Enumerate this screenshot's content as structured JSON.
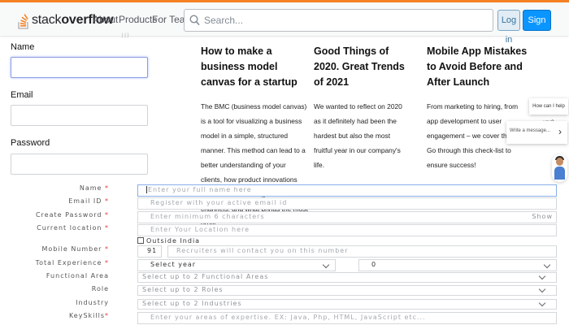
{
  "header": {
    "logo_text_light": "stack",
    "logo_text_bold": "overflow",
    "nav": [
      "About",
      "Products",
      "For Teams"
    ],
    "search_placeholder": "Search...",
    "login_label": "Log in",
    "signup_label": "Sign up",
    "colors": {
      "accent": "#f48024",
      "primary": "#0a95ff"
    }
  },
  "simple_form": {
    "stray_text": "|   |   )",
    "fields": [
      {
        "label": "Name",
        "value": ""
      },
      {
        "label": "Email",
        "value": ""
      },
      {
        "label": "Password",
        "value": ""
      }
    ]
  },
  "articles": [
    {
      "title": "How to make a business model canvas for a startup",
      "body": "The BMC (business model canvas) is a tool for visualizing a business model in a simple, structured manner. This method can lead to a better understanding of your clients, how product innovations are distributed through what channels, and what brings the most profit."
    },
    {
      "title": "Good Things of 2020. Great Trends of 2021",
      "body": "We wanted to reflect on 2020 as it definitely had been the hardest but also the most fruitful year in our company's life."
    },
    {
      "title": "Mobile App Mistakes to Avoid Before and After Launch",
      "body": "From marketing to hiring, from app development to user engagement – we cover them all. Go through this check-list to ensure success!"
    }
  ],
  "chat": {
    "bubble": "How can I help you?",
    "input_placeholder": "Write a message...",
    "send_icon": "chevron-right-icon",
    "avatar_icon": "support-agent-avatar"
  },
  "registration": {
    "required_marker": "*",
    "name": {
      "label": "Name",
      "placeholder": "Enter your full name here"
    },
    "email": {
      "label": "Email ID",
      "placeholder": "Register with your active email id"
    },
    "password": {
      "label": "Create Password",
      "placeholder": "Enter minimum 6 characters",
      "show_label": "Show"
    },
    "location": {
      "label": "Current location",
      "placeholder": "Enter Your Location here"
    },
    "outside_india": {
      "label": "Outside India",
      "checked": false
    },
    "mobile": {
      "label": "Mobile Number",
      "code": "91",
      "placeholder": "Recruiters will contact you on this number"
    },
    "experience": {
      "label": "Total Experience",
      "year_value": "Select year",
      "month_value": "0"
    },
    "functional_area": {
      "label": "Functional Area",
      "value": "Select up to 2 Functional Areas"
    },
    "role": {
      "label": "Role",
      "value": "Select up to 2 Roles"
    },
    "industry": {
      "label": "Industry",
      "value": "Select up to 2 Industries"
    },
    "keyskills": {
      "label": "KeySkills",
      "placeholder": "Enter your areas of expertise. EX: Java, Php, HTML, JavaScript etc..."
    }
  }
}
